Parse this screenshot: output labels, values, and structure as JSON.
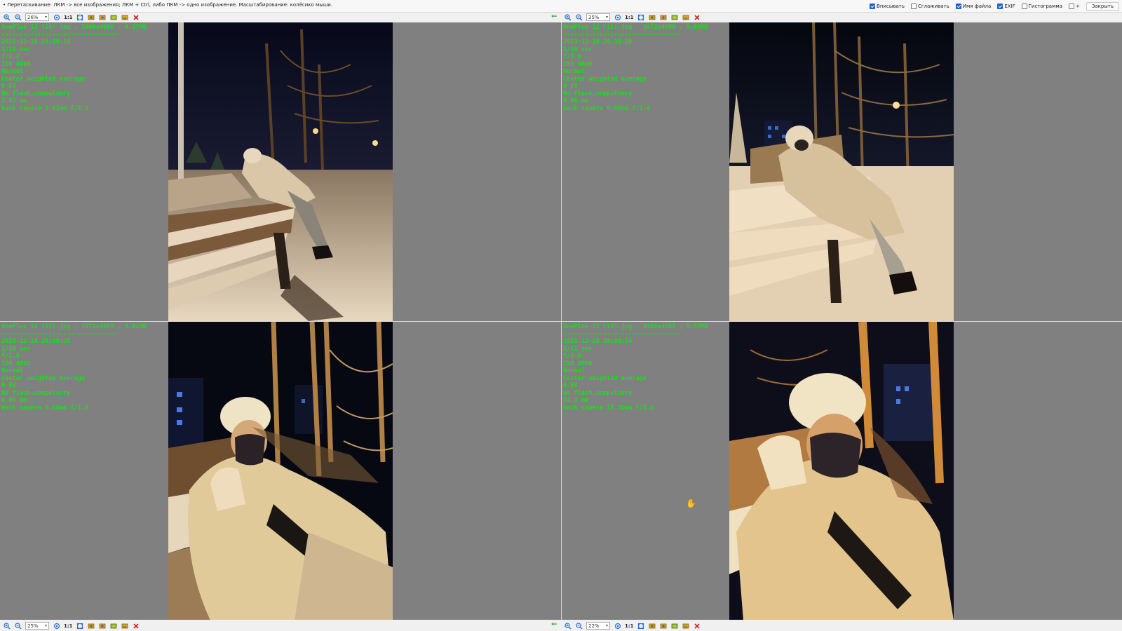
{
  "topbar": {
    "hint": "• Перетаскивание: ЛКМ -> все изображения; ЛКМ + Ctrl, либо ПКМ -> одно изображение. Масштабирование: колёсико мыши.",
    "options": [
      {
        "label": "Вписывать",
        "checked": true
      },
      {
        "label": "Сглаживать",
        "checked": false
      },
      {
        "label": "Имя файла",
        "checked": true
      },
      {
        "label": "EXIF",
        "checked": true
      },
      {
        "label": "Гистограмма",
        "checked": false
      },
      {
        "label": "+",
        "checked": false
      }
    ],
    "close_label": "Закрыть"
  },
  "toolbars": {
    "top_left": {
      "zoom": "26%",
      "one_to_one": "1:1"
    },
    "top_right": {
      "zoom": "25%",
      "one_to_one": "1:1"
    },
    "bottom_left": {
      "zoom": "25%",
      "one_to_one": "1:1"
    },
    "bottom_right": {
      "zoom": "22%",
      "one_to_one": "1:1"
    }
  },
  "panels": [
    {
      "filename_line": "OnePlus 12 (10).jpg , 3000x4000 , 4.27MB",
      "separator": "--------------------------------",
      "datetime": "2023-12-18 20:30:14",
      "exposure": "1/11 sec",
      "aperture": "f/2.2",
      "iso": "ISO 4000",
      "mode": "Normal",
      "metering": "Center weighted average",
      "ev": "0 EV",
      "flash": "No flash,compulsory",
      "focal": "2.62 mm",
      "lens": "back camera 2.62mm f/2.2"
    },
    {
      "filename_line": "OnePlus 12 (11).jpg , 3072x4096 , 5.69MB",
      "separator": "--------------------------------",
      "datetime": "2023-12-18 20:30:20",
      "exposure": "1/50 sec",
      "aperture": "f/1.6",
      "iso": "ISO 4000",
      "mode": "Normal",
      "metering": "Center weighted average",
      "ev": "0 EV",
      "flash": "No flash,compulsory",
      "focal": "6.06 mm",
      "lens": "back camera 6.06mm f/1.6"
    },
    {
      "filename_line": "OnePlus 12 (12).jpg , 3072x4096 , 4.01MB",
      "separator": "--------------------------------",
      "datetime": "2023-12-18 20:30:29",
      "exposure": "1/50 sec",
      "aperture": "f/1.6",
      "iso": "ISO 4000",
      "mode": "Normal",
      "metering": "Center weighted average",
      "ev": "0 EV",
      "flash": "No flash,compulsory",
      "focal": "6.06 mm",
      "lens": "back camera 6.06mm f/1.6"
    },
    {
      "filename_line": "OnePlus 12 (13).jpg , 3456x4608 , 5.59MB",
      "separator": "--------------------------------",
      "datetime": "2023-12-18 20:30:34",
      "exposure": "1/11 sec",
      "aperture": "f/2.6",
      "iso": "ISO 4000",
      "mode": "Normal",
      "metering": "Center weighted average",
      "ev": "0 EV",
      "flash": "No flash,compulsory",
      "focal": "13.3 mm",
      "lens": "back camera 13.30mm f/2.6"
    }
  ],
  "colors": {
    "exif_text": "#16e01a",
    "panel_bg": "#808080",
    "accent_checkbox": "#1a63c7",
    "close_red": "#d41a1a",
    "arrow_green": "#139a2c"
  }
}
